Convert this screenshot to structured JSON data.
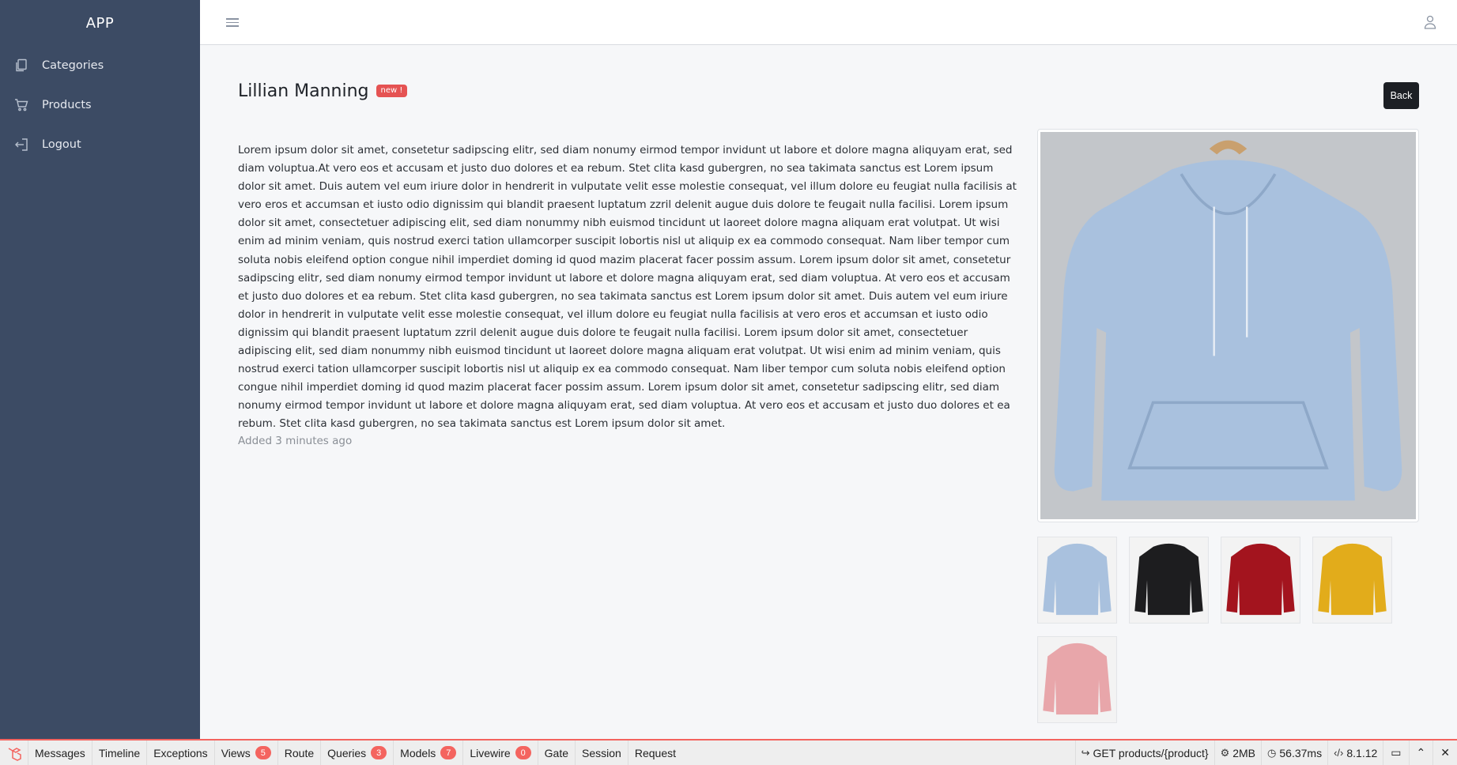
{
  "sidebar": {
    "brand": "APP",
    "items": [
      {
        "label": "Categories",
        "icon": "file-copy-icon"
      },
      {
        "label": "Products",
        "icon": "cart-icon"
      },
      {
        "label": "Logout",
        "icon": "logout-icon"
      }
    ]
  },
  "header": {
    "menu_icon": "hamburger-icon",
    "user_icon": "user-icon"
  },
  "product": {
    "title": "Lillian Manning",
    "badge": "new !",
    "back_label": "Back",
    "description": "Lorem ipsum dolor sit amet, consetetur sadipscing elitr, sed diam nonumy eirmod tempor invidunt ut labore et dolore magna aliquyam erat, sed diam voluptua.At vero eos et accusam et justo duo dolores et ea rebum. Stet clita kasd gubergren, no sea takimata sanctus est Lorem ipsum dolor sit amet. Duis autem vel eum iriure dolor in hendrerit in vulputate velit esse molestie consequat, vel illum dolore eu feugiat nulla facilisis at vero eros et accumsan et iusto odio dignissim qui blandit praesent luptatum zzril delenit augue duis dolore te feugait nulla facilisi. Lorem ipsum dolor sit amet, consectetuer adipiscing elit, sed diam nonummy nibh euismod tincidunt ut laoreet dolore magna aliquam erat volutpat. Ut wisi enim ad minim veniam, quis nostrud exerci tation ullamcorper suscipit lobortis nisl ut aliquip ex ea commodo consequat. Nam liber tempor cum soluta nobis eleifend option congue nihil imperdiet doming id quod mazim placerat facer possim assum. Lorem ipsum dolor sit amet, consetetur sadipscing elitr, sed diam nonumy eirmod tempor invidunt ut labore et dolore magna aliquyam erat, sed diam voluptua. At vero eos et accusam et justo duo dolores et ea rebum. Stet clita kasd gubergren, no sea takimata sanctus est Lorem ipsum dolor sit amet. Duis autem vel eum iriure dolor in hendrerit in vulputate velit esse molestie consequat, vel illum dolore eu feugiat nulla facilisis at vero eros et accumsan et iusto odio dignissim qui blandit praesent luptatum zzril delenit augue duis dolore te feugait nulla facilisi. Lorem ipsum dolor sit amet, consectetuer adipiscing elit, sed diam nonummy nibh euismod tincidunt ut laoreet dolore magna aliquam erat volutpat. Ut wisi enim ad minim veniam, quis nostrud exerci tation ullamcorper suscipit lobortis nisl ut aliquip ex ea commodo consequat. Nam liber tempor cum soluta nobis eleifend option congue nihil imperdiet doming id quod mazim placerat facer possim assum. Lorem ipsum dolor sit amet, consetetur sadipscing elitr, sed diam nonumy eirmod tempor invidunt ut labore et dolore magna aliquyam erat, sed diam voluptua. At vero eos et accusam et justo duo dolores et ea rebum. Stet clita kasd gubergren, no sea takimata sanctus est Lorem ipsum dolor sit amet.",
    "added": "Added 3 minutes ago",
    "main_image_color": "#a9c1de",
    "thumbnails": [
      {
        "color": "#a9c1de"
      },
      {
        "color": "#1d1d1f"
      },
      {
        "color": "#a3141e"
      },
      {
        "color": "#e2ac1b"
      },
      {
        "color": "#e8a6aa"
      }
    ]
  },
  "debugbar": {
    "tabs": [
      {
        "label": "Messages"
      },
      {
        "label": "Timeline"
      },
      {
        "label": "Exceptions"
      },
      {
        "label": "Views",
        "count": "5"
      },
      {
        "label": "Route"
      },
      {
        "label": "Queries",
        "count": "3"
      },
      {
        "label": "Models",
        "count": "7"
      },
      {
        "label": "Livewire",
        "count": "0"
      },
      {
        "label": "Gate"
      },
      {
        "label": "Session"
      },
      {
        "label": "Request"
      }
    ],
    "route": "GET products/{product}",
    "memory": "2MB",
    "time": "56.37ms",
    "php_version": "8.1.12",
    "accent": "#f4645f"
  }
}
